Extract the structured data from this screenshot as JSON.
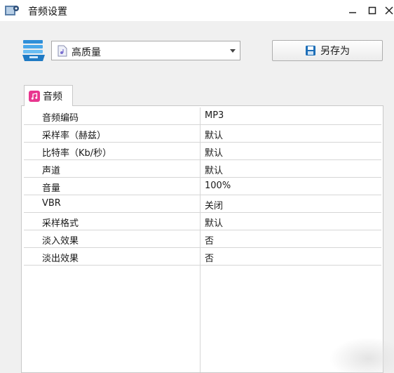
{
  "window": {
    "title": "音频设置"
  },
  "preset": {
    "selected": "高质量"
  },
  "toolbar": {
    "save_as_label": "另存为"
  },
  "tab": {
    "label": "音频"
  },
  "properties": [
    {
      "key": "音频编码",
      "value": "MP3"
    },
    {
      "key": "采样率（赫兹）",
      "value": "默认"
    },
    {
      "key": "比特率（Kb/秒）",
      "value": "默认"
    },
    {
      "key": "声道",
      "value": "默认"
    },
    {
      "key": "音量",
      "value": "100%"
    },
    {
      "key": "VBR",
      "value": "关闭"
    },
    {
      "key": "采样格式",
      "value": "默认"
    },
    {
      "key": "淡入效果",
      "value": "否"
    },
    {
      "key": "淡出效果",
      "value": "否"
    }
  ]
}
